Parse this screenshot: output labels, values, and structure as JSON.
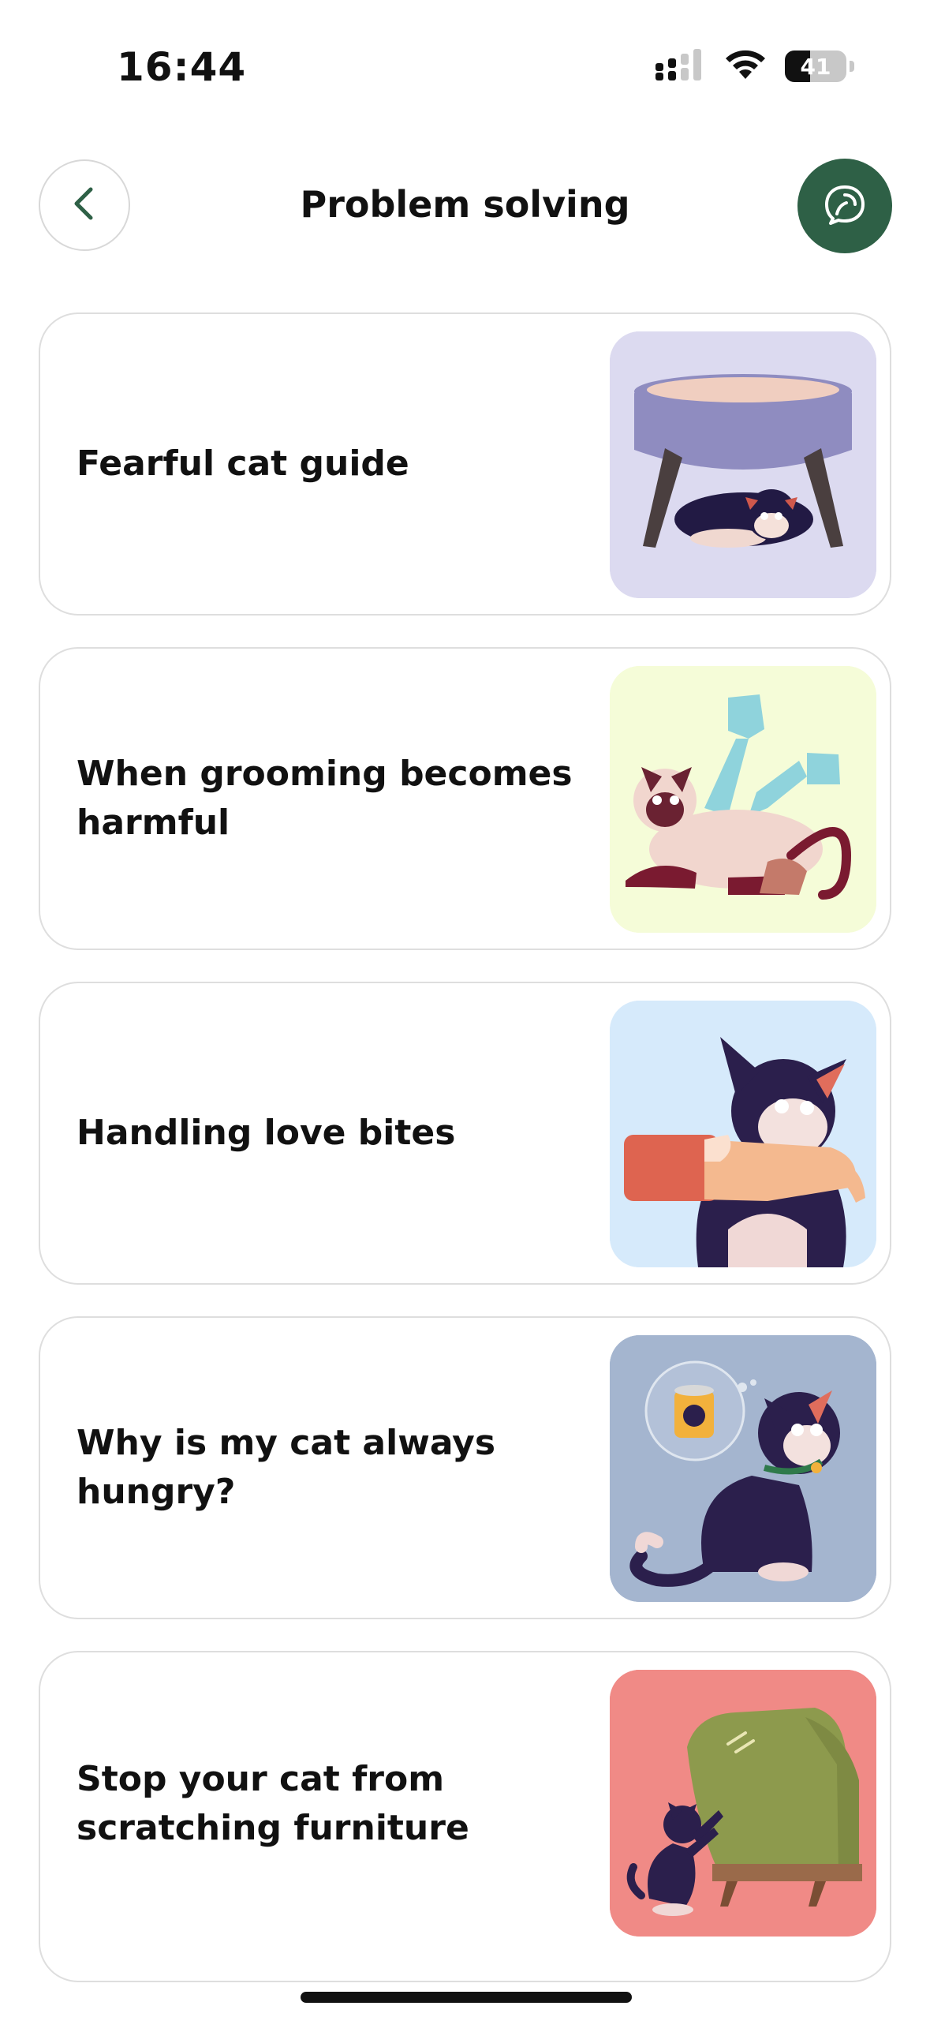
{
  "status_bar": {
    "time": "16:44",
    "battery": "41",
    "battery_level": 0.41
  },
  "header": {
    "title": "Problem solving",
    "back_icon": "chevron-left-icon",
    "help_icon": "chat-bubble-icon",
    "accent": "#2e6046"
  },
  "cards": [
    {
      "title": "Fearful cat guide",
      "image": "cat-hiding-under-stool",
      "bg": "#dcdaf0"
    },
    {
      "title": "When grooming becomes harmful",
      "image": "siamese-cat-with-gloved-hands",
      "bg": "#f5fcd8"
    },
    {
      "title": "Handling love bites",
      "image": "cat-biting-arm",
      "bg": "#d6eafb"
    },
    {
      "title": "Why is my cat always hungry?",
      "image": "cat-dreaming-of-food-can",
      "bg": "#a4b5cf"
    },
    {
      "title": "Stop your cat from scratching furniture",
      "image": "cat-scratching-armchair",
      "bg": "#f08a86"
    }
  ]
}
